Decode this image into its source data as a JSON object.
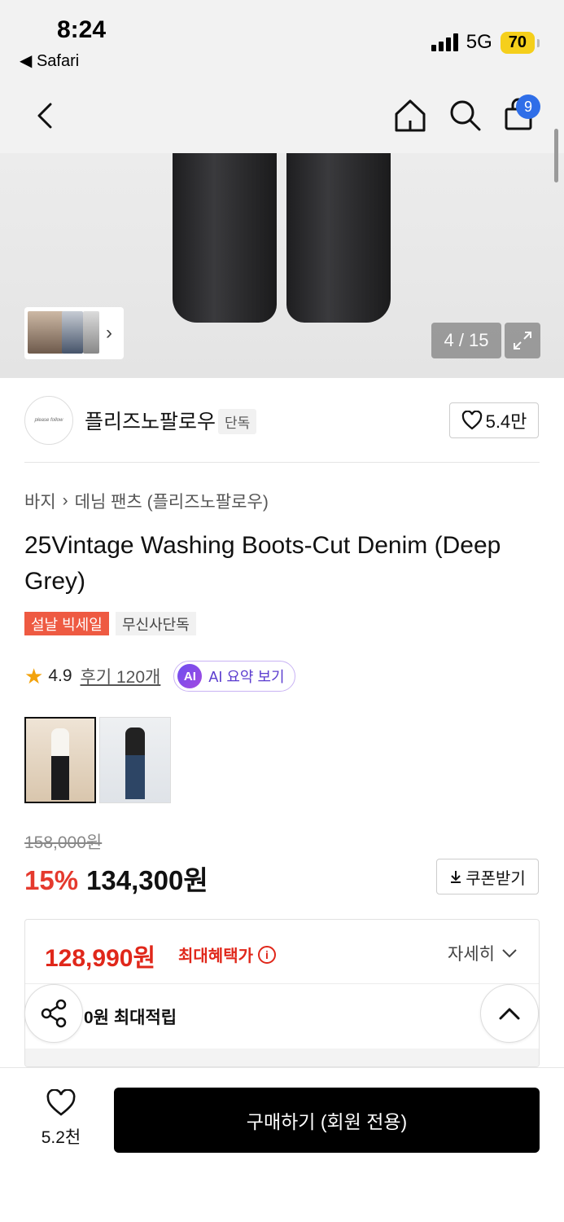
{
  "status": {
    "time": "8:24",
    "back_app": "◀ Safari",
    "network": "5G",
    "battery": "70"
  },
  "nav": {
    "cart_count": "9"
  },
  "gallery": {
    "counter": "4 / 15"
  },
  "brand": {
    "logo_text": "please follow",
    "name": "플리즈노팔로우",
    "tag": "단독",
    "likes": "5.4만"
  },
  "product": {
    "breadcrumb": [
      "바지",
      "데님 팬츠 (플리즈노팔로우)"
    ],
    "title": "25Vintage Washing Boots-Cut Denim (Deep Grey)",
    "badges": [
      "설날 빅세일",
      "무신사단독"
    ],
    "rating": "4.9",
    "reviews": "후기 120개",
    "ai_button": "AI 요약 보기",
    "ai_mark": "AI"
  },
  "price": {
    "original": "158,000원",
    "discount": "15%",
    "sale": "134,300원",
    "coupon": "쿠폰받기",
    "max_benefit_price": "128,990원",
    "max_benefit_label": "최대혜택가",
    "detail": "자세히",
    "points": "0원 최대적립"
  },
  "bottom": {
    "wish_count": "5.2천",
    "buy_label": "구매하기 (회원 전용)"
  },
  "colors": {
    "accent_red": "#e53a2e",
    "sale_badge": "#ee5a42",
    "cart_badge": "#2f6ee8",
    "battery": "#f5cf1b"
  }
}
